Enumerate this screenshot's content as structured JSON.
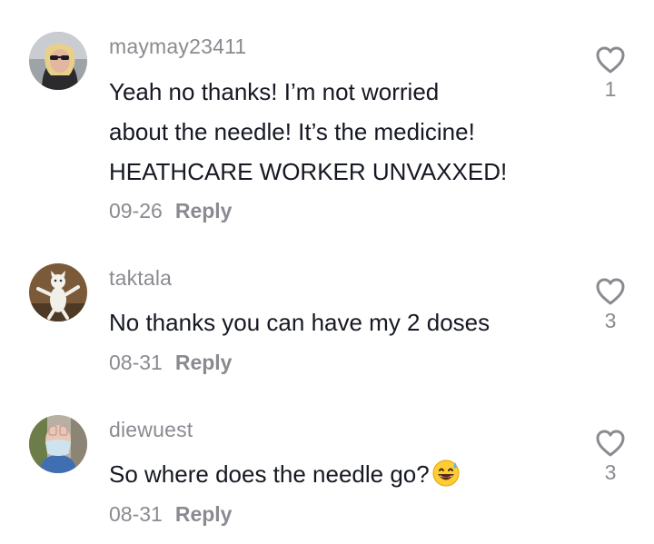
{
  "comments": [
    {
      "username": "maymay23411",
      "text_lines": [
        "Yeah no thanks! I’m not worried",
        "about the needle! It’s the medicine!",
        "HEATHCARE WORKER UNVAXXED!"
      ],
      "date": "09-26",
      "reply_label": "Reply",
      "like_count": "1",
      "avatar": "woman-with-sunglasses-avatar"
    },
    {
      "username": "taktala",
      "text": "No thanks you can have my 2 doses",
      "date": "08-31",
      "reply_label": "Reply",
      "like_count": "3",
      "avatar": "white-cat-figure-avatar"
    },
    {
      "username": "diewuest",
      "text": "So where does the needle go?",
      "emoji": "grinning-sweat-emoji",
      "date": "08-31",
      "reply_label": "Reply",
      "like_count": "3",
      "avatar": "masked-person-avatar"
    }
  ],
  "colors": {
    "text": "#161823",
    "muted": "#8a8b91",
    "background": "#ffffff"
  }
}
